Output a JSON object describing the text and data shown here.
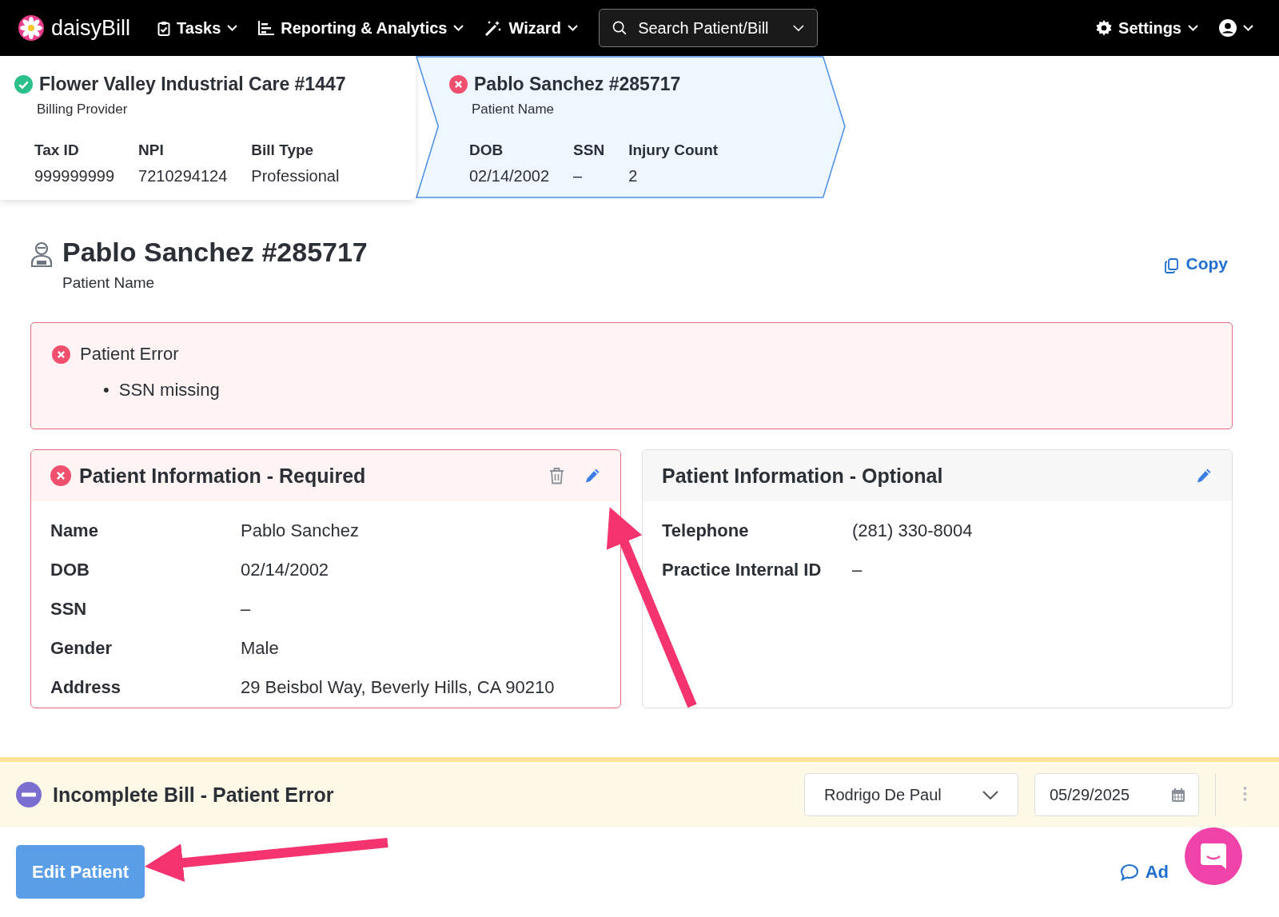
{
  "nav": {
    "brand": "daisyBill",
    "menus": [
      {
        "label": "Tasks"
      },
      {
        "label": "Reporting & Analytics"
      },
      {
        "label": "Wizard"
      }
    ],
    "search": {
      "placeholder": "Search Patient/Bill"
    },
    "settings": "Settings"
  },
  "breadcrumb": [
    {
      "kind": "ok",
      "title": "Flower Valley Industrial Care #1447",
      "subtitle": "Billing Provider",
      "selected": false,
      "fields": [
        {
          "label": "Tax ID",
          "value": "999999999"
        },
        {
          "label": "NPI",
          "value": "7210294124"
        },
        {
          "label": "Bill Type",
          "value": "Professional"
        }
      ]
    },
    {
      "kind": "error",
      "title": "Pablo Sanchez #285717",
      "subtitle": "Patient Name",
      "selected": true,
      "fields": [
        {
          "label": "DOB",
          "value": "02/14/2002"
        },
        {
          "label": "SSN",
          "value": "–"
        },
        {
          "label": "Injury Count",
          "value": "2"
        }
      ]
    }
  ],
  "header": {
    "title": "Pablo Sanchez #285717",
    "subtitle": "Patient Name",
    "copy": "Copy"
  },
  "error_box": {
    "title": "Patient Error",
    "items": [
      {
        "bullet": "•",
        "text": "SSN missing"
      }
    ]
  },
  "cards": [
    {
      "title": "Patient Information - Required",
      "kind": "error",
      "deletable": true,
      "rows": [
        {
          "label": "Name",
          "value": "Pablo Sanchez"
        },
        {
          "label": "DOB",
          "value": "02/14/2002"
        },
        {
          "label": "SSN",
          "value": "–"
        },
        {
          "label": "Gender",
          "value": "Male"
        },
        {
          "label": "Address",
          "value": "29 Beisbol Way, Beverly Hills, CA 90210"
        }
      ]
    },
    {
      "title": "Patient Information - Optional",
      "kind": "plain",
      "deletable": false,
      "rows": [
        {
          "label": "Telephone",
          "value": "(281) 330-8004"
        },
        {
          "label": "Practice Internal ID",
          "value": "–"
        }
      ]
    }
  ],
  "footer": {
    "status": "Incomplete Bill - Patient Error",
    "assignee": "Rodrigo De Paul",
    "date": "05/29/2025",
    "primary_button": "Edit Patient",
    "link": "Ad"
  }
}
